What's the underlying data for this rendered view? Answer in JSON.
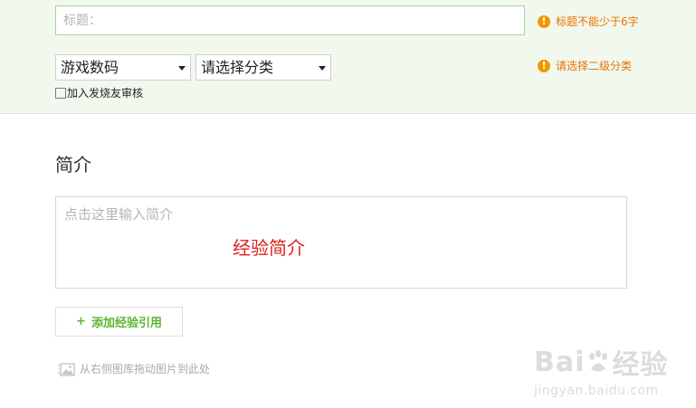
{
  "title_field": {
    "placeholder": "标题：",
    "warning": "标题不能少于6字"
  },
  "category": {
    "primary_selected": "游戏数码",
    "secondary_selected": "请选择分类",
    "warning": "请选择二级分类"
  },
  "review_checkbox": {
    "label": "加入发烧友审核",
    "checked": false
  },
  "intro_section": {
    "title": "简介",
    "placeholder": "点击这里输入简介",
    "annotation": "经验简介"
  },
  "add_reference_button": {
    "plus": "+",
    "label": "添加经验引用"
  },
  "drag_hint": "从右侧图库拖动图片到此处",
  "watermark": {
    "logo_left": "Bai",
    "logo_right": "经验",
    "url": "jingyan.baidu.com"
  },
  "colors": {
    "accent_green": "#5cb531",
    "warning_orange": "#e87400",
    "annotation_red": "#e02020",
    "panel_bg": "#f1f8ee"
  },
  "icons": {
    "warning": "exclamation-circle-icon",
    "dropdown": "triangle-down-icon",
    "image": "image-icon"
  }
}
